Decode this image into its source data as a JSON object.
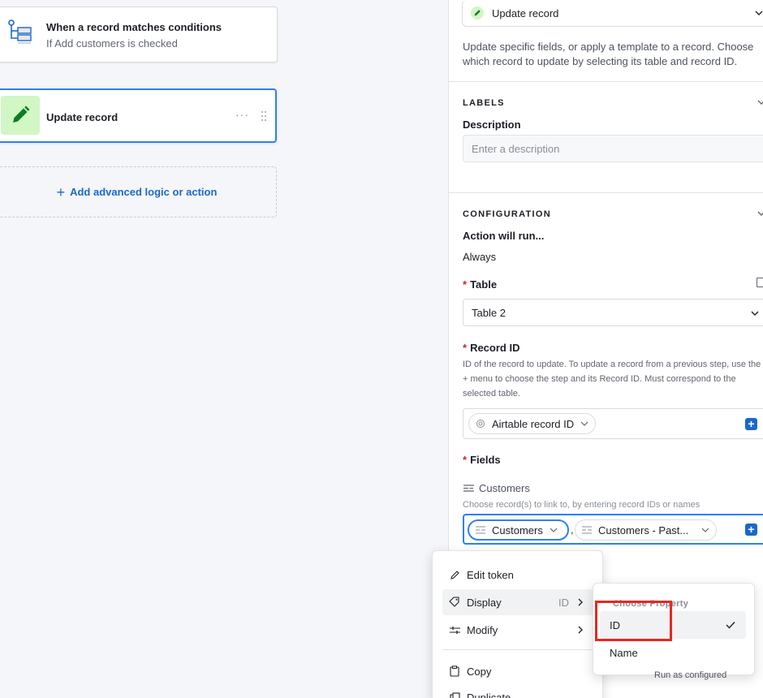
{
  "canvas": {
    "trigger": {
      "title": "When a record matches conditions",
      "subtitle": "If Add customers is checked"
    },
    "action": {
      "title": "Update record",
      "more": "···"
    },
    "add_step": {
      "label": "Add advanced logic or action",
      "plus": "+"
    }
  },
  "panel": {
    "action_type": "Update record",
    "description": "Update specific fields, or apply a template to a record. Choose which record to update by selecting its table and record ID.",
    "labels": {
      "heading": "LABELS",
      "description_label": "Description",
      "description_placeholder": "Enter a description"
    },
    "configuration": {
      "heading": "CONFIGURATION",
      "run_label": "Action will run...",
      "run_value": "Always",
      "table_label": "Table",
      "table_value": "Table 2",
      "record_id_label": "Record ID",
      "record_id_help": "ID of the record to update. To update a record from a previous step, use the + menu to choose the step and its Record ID. Must correspond to the selected table.",
      "record_id_token": "Airtable record ID",
      "fields_label": "Fields",
      "field_name": "Customers",
      "field_help": "Choose record(s) to link to, by entering record IDs or names",
      "tokens": [
        "Customers",
        "Customers - Past..."
      ],
      "separator": ","
    },
    "run_as": "Run as configured"
  },
  "context_menu": {
    "items": [
      {
        "label": "Edit token",
        "icon": "pencil-icon"
      },
      {
        "label": "Display",
        "meta": "ID",
        "icon": "tag-icon",
        "has_submenu": true
      },
      {
        "label": "Modify",
        "icon": "sliders-icon",
        "has_submenu": true
      },
      {
        "label": "Copy",
        "icon": "clipboard-icon"
      },
      {
        "label": "Duplicate",
        "icon": "duplicate-icon"
      }
    ]
  },
  "submenu": {
    "heading": "Choose Property",
    "options": [
      {
        "label": "ID",
        "selected": true
      },
      {
        "label": "Name",
        "selected": false
      }
    ]
  },
  "colors": {
    "accent": "#2d7ff9",
    "link": "#1c68c9",
    "highlight": "#e8281e",
    "action_bg": "#d1f7c4",
    "action_icon": "#0b7c27"
  }
}
